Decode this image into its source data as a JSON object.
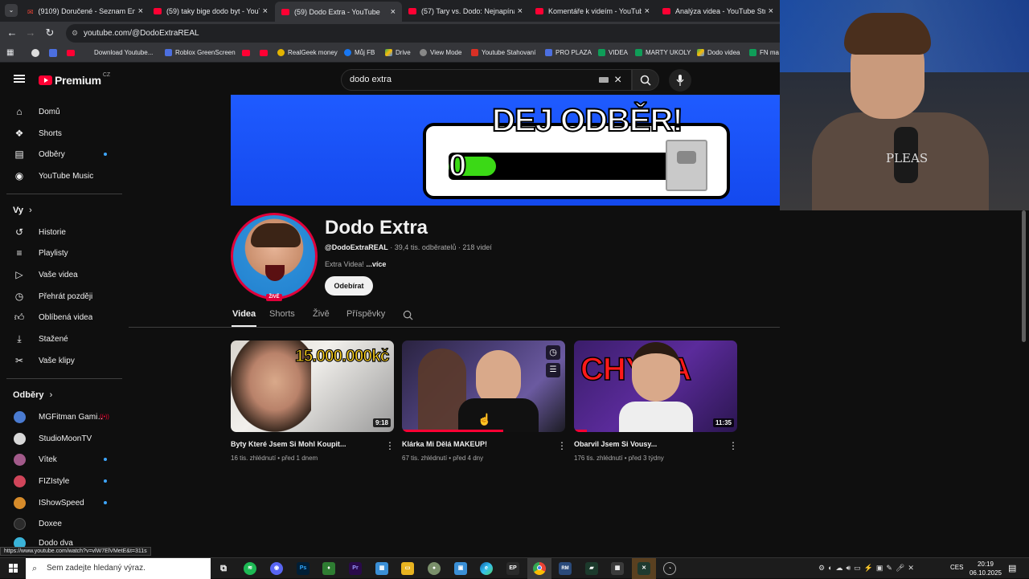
{
  "browser": {
    "tabs": [
      {
        "label": "(9109) Doručené - Seznam Em…",
        "icon": "seznam-mail-icon"
      },
      {
        "label": "(59) taky bige dodo byt - YouTu",
        "icon": "youtube-icon"
      },
      {
        "label": "(59) Dodo Extra - YouTube",
        "icon": "youtube-icon",
        "active": true
      },
      {
        "label": "(57) Tary vs. Dodo: Nejnapínav…",
        "icon": "youtube-icon"
      },
      {
        "label": "Komentáře k videím - YouTube",
        "icon": "youtube-icon"
      },
      {
        "label": "Analýza videa - YouTube Studio",
        "icon": "youtube-icon"
      }
    ],
    "url": "youtube.com/@DodoExtraREAL",
    "bookmarks": [
      "Download Youtube...",
      "Roblox GreenScreen",
      "RealGeek money",
      "Můj FB",
      "Drive",
      "View Mode",
      "Youtube Stahovaní",
      "PRO PLAZA",
      "VIDEA",
      "MARTY UKOLY",
      "Dodo videa",
      "FN ma"
    ],
    "status_url": "https://www.youtube.com/watch?v=vlW7ElVMetE&t=311s"
  },
  "masthead": {
    "logo_text": "Premium",
    "logo_region": "CZ",
    "search_value": "dodo extra"
  },
  "sidebar": {
    "main": [
      {
        "label": "Domů",
        "icon": "home-icon"
      },
      {
        "label": "Shorts",
        "icon": "shorts-icon"
      },
      {
        "label": "Odběry",
        "icon": "subscriptions-icon",
        "dot": true
      },
      {
        "label": "YouTube Music",
        "icon": "music-icon"
      }
    ],
    "you_header": "Vy",
    "you": [
      {
        "label": "Historie",
        "icon": "history-icon"
      },
      {
        "label": "Playlisty",
        "icon": "playlists-icon"
      },
      {
        "label": "Vaše videa",
        "icon": "your-videos-icon"
      },
      {
        "label": "Přehrát později",
        "icon": "watch-later-icon"
      },
      {
        "label": "Oblíbená videa",
        "icon": "liked-icon"
      },
      {
        "label": "Stažené",
        "icon": "download-icon"
      },
      {
        "label": "Vaše klipy",
        "icon": "clips-icon"
      }
    ],
    "subs_header": "Odběry",
    "subs": [
      {
        "label": "MGFitman Gami…",
        "live": true,
        "color": "#4a7bd1"
      },
      {
        "label": "StudioMoonTV",
        "live": false,
        "color": "#d8d8d8"
      },
      {
        "label": "Vítek",
        "live": false,
        "dot": true,
        "color": "#a25a8a"
      },
      {
        "label": "FIZIstyle",
        "live": false,
        "dot": true,
        "color": "#d0455a"
      },
      {
        "label": "IShowSpeed",
        "live": false,
        "dot": true,
        "color": "#d68b2a"
      },
      {
        "label": "Doxee",
        "live": false,
        "color": "#2b2b2b"
      },
      {
        "label": "Dodo dva",
        "live": false,
        "color": "#3ab3d8"
      }
    ]
  },
  "banner": {
    "headline": "DEJ ODBĚR!",
    "counter": "0",
    "progress_fraction": 0.2
  },
  "channel": {
    "name": "Dodo Extra",
    "handle": "@DodoExtraREAL",
    "subscribers": "39,4 tis. odběratelů",
    "videos": "218 videí",
    "description": "Extra Videa!",
    "more": "...více",
    "live_badge": "ŽIVĚ",
    "subscribe_label": "Odebírat"
  },
  "tabs": [
    "Videa",
    "Shorts",
    "Živě",
    "Příspěvky"
  ],
  "videos": [
    {
      "title": "Byty Které Jsem Si Mohl Koupit...",
      "views": "16 tis. zhlédnutí",
      "age": "před 1 dnem",
      "duration": "9:18",
      "thumb_text": "15.000.000kč",
      "progress": 0
    },
    {
      "title": "Klárka Mi Dělá MAKEUP!",
      "views": "67 tis. zhlédnutí",
      "age": "před 4 dny",
      "duration": "",
      "thumb_text": "",
      "progress": 0.62
    },
    {
      "title": "Obarvil Jsem Si Vousy...",
      "views": "176 tis. zhlédnutí",
      "age": "před 3 týdny",
      "duration": "11:35",
      "thumb_text": "CHYBA",
      "progress": 0.08
    }
  ],
  "webcam": {
    "shirt_text": "PLEAS"
  },
  "taskbar": {
    "search_placeholder": "Sem zadejte hledaný výraz.",
    "apps": [
      "task-view",
      "spotify",
      "discord",
      "photoshop",
      "app",
      "premiere",
      "store",
      "explorer",
      "app2",
      "app3",
      "edge",
      "epic",
      "chrome",
      "app4",
      "app5",
      "calculator",
      "app6",
      "app7"
    ],
    "language": "CES",
    "time": "20:19",
    "date": "06.10.2025"
  },
  "colors": {
    "youtube_red": "#ff0033",
    "background": "#0f0f0f",
    "banner_blue": "#1449ee",
    "link_blue": "#3ea6ff"
  }
}
